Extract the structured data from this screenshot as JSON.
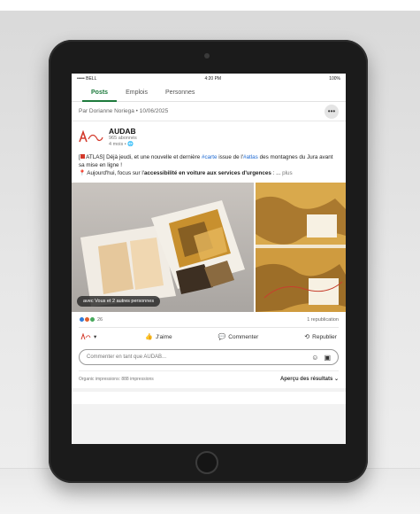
{
  "status_bar": {
    "carrier": "••••• BELL",
    "time": "4:20 PM",
    "battery": "100%"
  },
  "tabs": [
    {
      "label": "Posts",
      "active": true
    },
    {
      "label": "Emplois",
      "active": false
    },
    {
      "label": "Personnes",
      "active": false
    }
  ],
  "repost": {
    "text": "Par Dorianne Noriega • 10/06/2025",
    "more": "•••"
  },
  "post": {
    "logo_text": "AUDAB",
    "author_name": "AUDAB",
    "followers": "965 abonnés",
    "time_ago": "4 mois • ",
    "text_1": "[",
    "text_2": " ATLAS] Déjà jeudi, et une nouvelle et dernière ",
    "hashtag_carte": "#carte",
    "text_3": " issue de l'",
    "hashtag_atlas": "#atlas",
    "text_4": " des montagnes du Jura avant sa mise en ligne !",
    "pin": "📍",
    "text_5": " Aujourd'hui, focus sur l'",
    "bold_text": "accessibilité en voiture aux services d'urgences",
    "text_6": " : ...",
    "see_more": "plus",
    "tag_pill": "avec Vous et 2 autres personnes"
  },
  "reactions": {
    "count": "26",
    "reposts": "1 republication"
  },
  "actions": {
    "react": "",
    "like": "J'aime",
    "comment": "Commenter",
    "repost": "Republier"
  },
  "comment_box": {
    "placeholder": "Commenter en tant que AUDAB..."
  },
  "footer": {
    "impressions": "Organic impressions: 888 impressions",
    "results": "Aperçu des résultats"
  },
  "colors": {
    "accent_green": "#1d7a3c",
    "hashtag_blue": "#1e6ad2",
    "brand_red": "#d3392b"
  }
}
